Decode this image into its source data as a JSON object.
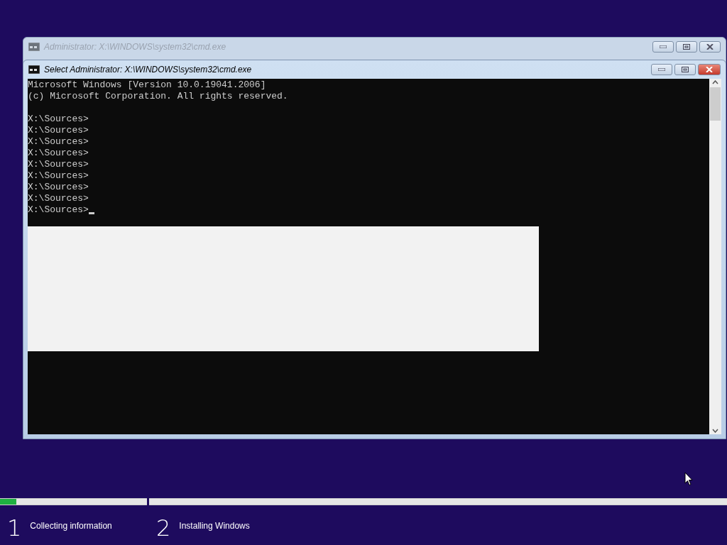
{
  "windows": [
    {
      "title": "Administrator: X:\\WINDOWS\\system32\\cmd.exe",
      "active": false
    },
    {
      "title": "Select Administrator: X:\\WINDOWS\\system32\\cmd.exe",
      "active": true,
      "banner": [
        "Microsoft Windows [Version 10.0.19041.2006]",
        "(c) Microsoft Corporation. All rights reserved."
      ],
      "prompts": [
        "X:\\Sources>",
        "X:\\Sources>",
        "X:\\Sources>",
        "X:\\Sources>",
        "X:\\Sources>",
        "X:\\Sources>",
        "X:\\Sources>",
        "X:\\Sources>",
        "X:\\Sources>"
      ]
    }
  ],
  "setup_steps": [
    {
      "number": "1",
      "label": "Collecting information",
      "level": 0.11
    },
    {
      "number": "2",
      "label": "Installing Windows"
    }
  ]
}
